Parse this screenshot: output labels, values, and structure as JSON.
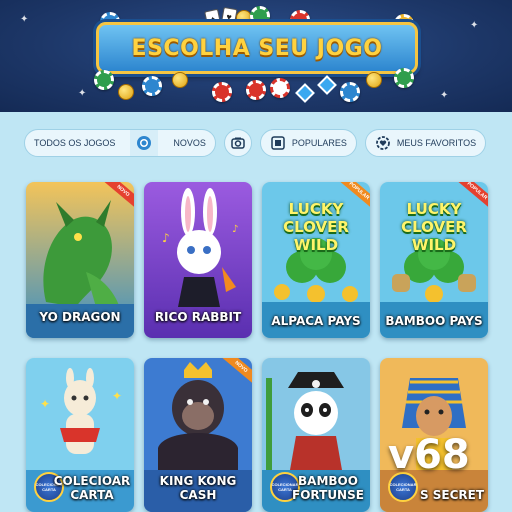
{
  "header": {
    "title": "ESCOLHA SEU JOGO"
  },
  "tabs": [
    {
      "label": "TODOS OS JOGOS",
      "icon": "poker-chip-icon"
    },
    {
      "label": "NOVOS",
      "icon": ""
    },
    {
      "label": "",
      "icon": "camera-icon"
    },
    {
      "label": "POPULARES",
      "icon": "cards-icon"
    },
    {
      "label": "MEUS FAVORITOS",
      "icon": "heart-gear-icon"
    }
  ],
  "games": [
    {
      "name": "YO DRAGON",
      "ribbon": "NOVO",
      "art": "dragon"
    },
    {
      "name": "RICO RABBIT",
      "ribbon": "",
      "art": "rabbit"
    },
    {
      "name": "ALPACA PAYS",
      "ribbon": "POPULAR",
      "art": "clover",
      "logo": "LUCKY CLOVER WILD"
    },
    {
      "name": "BAMBOO PAYS",
      "ribbon": "POPULAR",
      "art": "clover",
      "logo": "LUCKY CLOVER WILD"
    },
    {
      "name": "COLECIOAR CARTA",
      "ribbon": "",
      "art": "alpaca",
      "badge": "COLECIONAR CARTA"
    },
    {
      "name": "KING KONG CASH",
      "ribbon": "NOVO",
      "art": "gorilla"
    },
    {
      "name": "BAMBOO FORTUNSE",
      "ribbon": "",
      "art": "panda",
      "badge": "COLECIONAR CARTA"
    },
    {
      "name": "S SECRET",
      "ribbon": "",
      "art": "pharaoh",
      "badge": "COLECIONAR CARTA"
    }
  ],
  "watermark": "v68",
  "colors": {
    "page_bg": "#bfe6f4",
    "header_bg": "#1d3768",
    "title_gold": "#ffd23f",
    "accent_blue": "#2d86cf"
  }
}
